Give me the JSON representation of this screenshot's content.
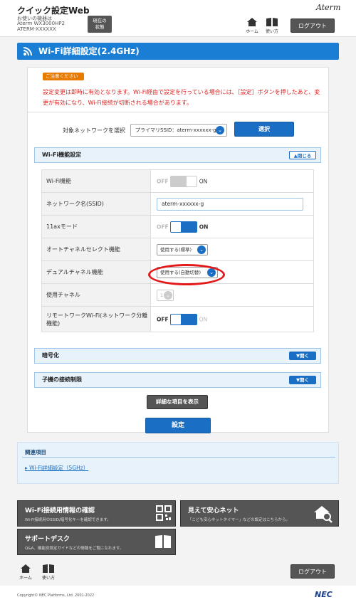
{
  "header": {
    "title": "クイック設定Web",
    "device_label": "お使いの機器は",
    "model": "Aterm WX3000HP2",
    "device_id": "ATERM-XXXXXX",
    "status_button": "現在の\n状態",
    "brand": "Aterm",
    "home_label": "ホーム",
    "help_label": "使い方",
    "logout_label": "ログアウト"
  },
  "page_title": "Wi-Fi詳細設定(2.4GHz)",
  "notice": {
    "badge": "ご注意ください",
    "text": "設定変更は即時に有効となります。Wi-Fi経由で設定を行っている場合には、［設定］ボタンを押したあと、変更が有効になり、Wi-Fi接続が切断される場合があります。"
  },
  "network_select": {
    "label": "対象ネットワークを選択",
    "value": "プライマリSSID：aterm-xxxxxx-g",
    "button": "選択"
  },
  "wifi_section": {
    "title": "Wi-Fi機能設定",
    "toggle": "閉じる",
    "rows": [
      {
        "label": "Wi-Fi機能",
        "off": "OFF",
        "on": "ON"
      },
      {
        "label": "ネットワーク名(SSID)",
        "value": "aterm-xxxxxx-g"
      },
      {
        "label": "11axモード",
        "off": "OFF",
        "on": "ON"
      },
      {
        "label": "オートチャネルセレクト機能",
        "value": "使用する(標準)"
      },
      {
        "label": "デュアルチャネル機能",
        "value": "使用する(自動切替)"
      },
      {
        "label": "使用チャネル",
        "value": "1"
      },
      {
        "label": "リモートワークWi-Fi(ネットワーク分離機能)",
        "off": "OFF",
        "on": "ON"
      }
    ]
  },
  "encryption_section": {
    "title": "暗号化",
    "toggle": "開く"
  },
  "client_limit_section": {
    "title": "子機の接続制限",
    "toggle": "開く"
  },
  "show_details_button": "詳細な項目を表示",
  "save_button": "設定",
  "related": {
    "title": "関連項目",
    "link": "Wi-Fi詳細設定（5GHz）"
  },
  "tiles": [
    {
      "title": "Wi-Fi接続用情報の確認",
      "desc": "Wi-Fi接続用のSSID/暗号化キーを確認できます。"
    },
    {
      "title": "見えて安心ネット",
      "desc": "「こども安心ネットタイマー」などの設定はこちらから。"
    },
    {
      "title": "サポートデスク",
      "desc": "Q&A、機能別設定ガイドなどの情報をご覧になれます。"
    }
  ],
  "footer": {
    "home_label": "ホーム",
    "help_label": "使い方",
    "logout_label": "ログアウト",
    "copyright": "Copyright© NEC Platforms, Ltd. 2001-2022",
    "brand": "NEC"
  },
  "colors": {
    "accent": "#1a7fd4",
    "button_blue": "#1a6fc4",
    "button_gray": "#555555",
    "warning": "#dd2222",
    "badge": "#e87a00",
    "highlight": "#e21a1a"
  }
}
